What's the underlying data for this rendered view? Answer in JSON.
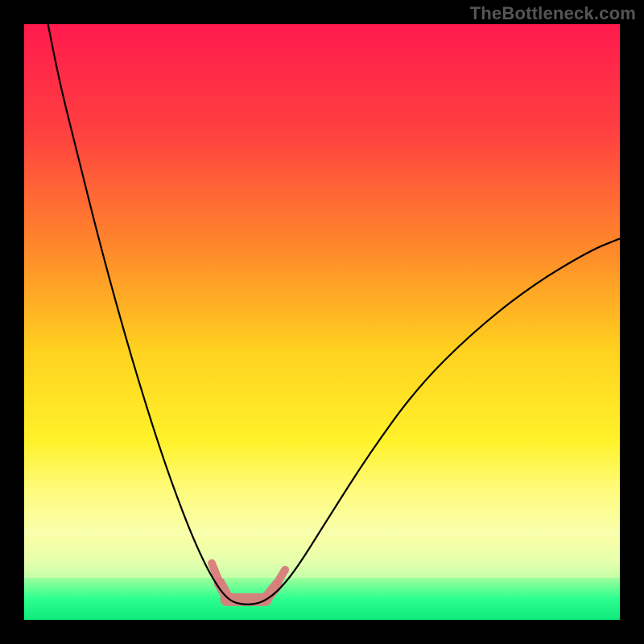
{
  "attribution": "TheBottleneck.com",
  "chart_data": {
    "type": "line",
    "title": "",
    "xlabel": "",
    "ylabel": "",
    "xlim": [
      0,
      100
    ],
    "ylim": [
      0,
      100
    ],
    "background_gradient": {
      "stops": [
        {
          "pos": 0.0,
          "color": "#ff1a4d"
        },
        {
          "pos": 0.18,
          "color": "#ff4040"
        },
        {
          "pos": 0.38,
          "color": "#ff8a2a"
        },
        {
          "pos": 0.55,
          "color": "#ffd21f"
        },
        {
          "pos": 0.7,
          "color": "#fff22a"
        },
        {
          "pos": 0.78,
          "color": "#fffb7a"
        },
        {
          "pos": 0.86,
          "color": "#f8ffb0"
        },
        {
          "pos": 0.905,
          "color": "#d7ffb0"
        },
        {
          "pos": 0.935,
          "color": "#8dff9a"
        },
        {
          "pos": 0.965,
          "color": "#2cff8f"
        },
        {
          "pos": 1.0,
          "color": "#10e97c"
        }
      ]
    },
    "series": [
      {
        "name": "bottleneck-curve",
        "color": "#000000",
        "width": 2.2,
        "points": [
          {
            "x": 4.0,
            "y": 100.0
          },
          {
            "x": 6.0,
            "y": 90.0
          },
          {
            "x": 9.0,
            "y": 78.0
          },
          {
            "x": 13.0,
            "y": 62.0
          },
          {
            "x": 18.0,
            "y": 44.0
          },
          {
            "x": 23.0,
            "y": 28.0
          },
          {
            "x": 27.0,
            "y": 17.0
          },
          {
            "x": 30.0,
            "y": 10.0
          },
          {
            "x": 32.5,
            "y": 5.5
          },
          {
            "x": 34.5,
            "y": 3.2
          },
          {
            "x": 36.5,
            "y": 2.6
          },
          {
            "x": 38.5,
            "y": 2.6
          },
          {
            "x": 40.5,
            "y": 3.2
          },
          {
            "x": 43.0,
            "y": 5.2
          },
          {
            "x": 46.0,
            "y": 9.0
          },
          {
            "x": 51.0,
            "y": 17.0
          },
          {
            "x": 58.0,
            "y": 28.0
          },
          {
            "x": 66.0,
            "y": 39.0
          },
          {
            "x": 75.0,
            "y": 48.0
          },
          {
            "x": 85.0,
            "y": 56.0
          },
          {
            "x": 95.0,
            "y": 62.0
          },
          {
            "x": 100.0,
            "y": 64.0
          }
        ]
      }
    ],
    "annotations": {
      "minimum_marker": {
        "color": "#d97c7c",
        "opacity": 0.95,
        "segments": [
          {
            "x1": 31.5,
            "y1": 9.5,
            "x2": 32.8,
            "y2": 6.2,
            "w": 10
          },
          {
            "x1": 32.8,
            "y1": 6.2,
            "x2": 34.0,
            "y2": 4.0,
            "w": 14
          },
          {
            "x1": 34.0,
            "y1": 3.4,
            "x2": 40.5,
            "y2": 3.4,
            "w": 16
          },
          {
            "x1": 40.8,
            "y1": 3.8,
            "x2": 42.4,
            "y2": 5.8,
            "w": 14
          },
          {
            "x1": 42.6,
            "y1": 6.4,
            "x2": 43.8,
            "y2": 8.4,
            "w": 10
          }
        ]
      }
    },
    "threshold_bands": [
      {
        "y_from": 7.0,
        "y_to": 14.0,
        "color_top": "#fcff9a",
        "color_bottom": "#eaffb0"
      }
    ]
  }
}
